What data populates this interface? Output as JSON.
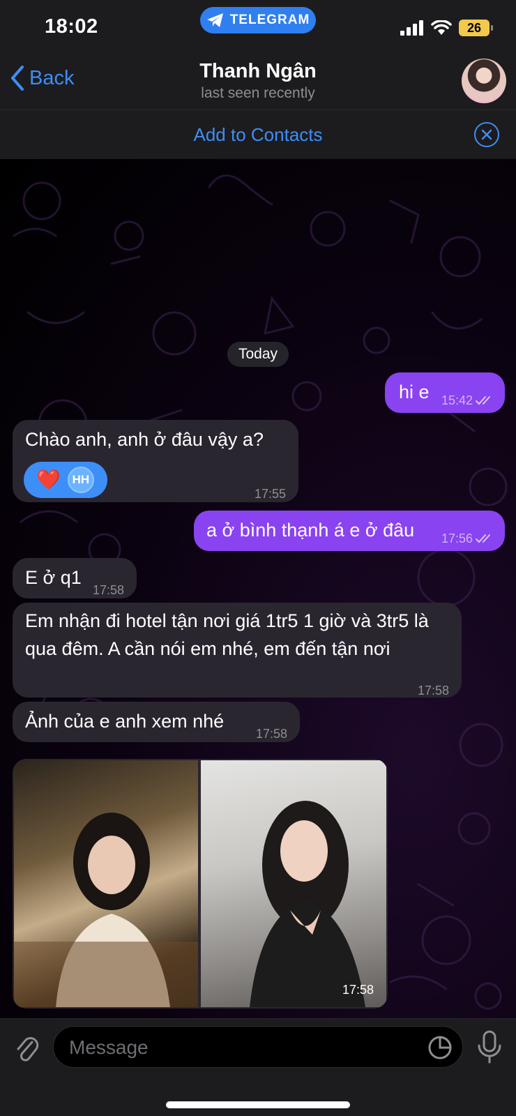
{
  "status_bar": {
    "time": "18:02",
    "app_pill": "TELEGRAM",
    "battery": "26"
  },
  "header": {
    "back_label": "Back",
    "name": "Thanh Ngân",
    "status": "last seen recently"
  },
  "add_contact": {
    "label": "Add to Contacts"
  },
  "chat": {
    "date_label": "Today",
    "messages": [
      {
        "direction": "out",
        "text": "hi e",
        "time": "15:42"
      },
      {
        "direction": "in",
        "text": "Chào anh, anh ở đâu vậy a?",
        "time": "17:55",
        "reaction_emoji": "❤️",
        "reaction_user": "HH"
      },
      {
        "direction": "out",
        "text": "a ở bình thạnh á e ở đâu",
        "time": "17:56"
      },
      {
        "direction": "in",
        "text": "E ở q1",
        "time": "17:58"
      },
      {
        "direction": "in",
        "text": "Em nhận đi hotel tận nơi giá 1tr5 1 giờ và 3tr5 là qua đêm. A cần nói em nhé, em đến tận nơi",
        "time": "17:58"
      },
      {
        "direction": "in",
        "text": "Ảnh của e anh xem nhé",
        "time": "17:58"
      },
      {
        "direction": "in",
        "type": "photo_album",
        "time": "17:58"
      }
    ]
  },
  "input": {
    "placeholder": "Message"
  },
  "colors": {
    "accent": "#3e8ef7",
    "outgoing_bubble": "#8a43f0",
    "incoming_bubble": "#2a2630",
    "bar_background": "#1c1c1e"
  },
  "icons": {
    "back": "chevron-left-icon",
    "close": "close-circle-icon",
    "attach": "paperclip-icon",
    "sticker": "sticker-icon",
    "mic": "microphone-icon",
    "read": "double-check-icon"
  }
}
